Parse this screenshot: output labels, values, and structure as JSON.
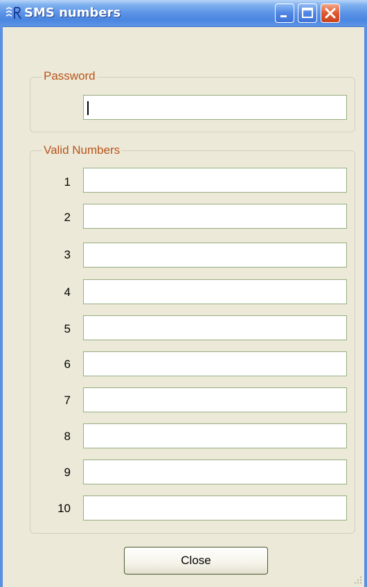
{
  "window": {
    "title": "SMS numbers",
    "app_icon": "app-logo-icon",
    "controls": [
      "minimize-icon",
      "maximize-icon",
      "close-icon"
    ]
  },
  "password_group": {
    "legend": "Password",
    "field_value": ""
  },
  "numbers_group": {
    "legend": "Valid Numbers",
    "rows": [
      {
        "label": "1",
        "value": ""
      },
      {
        "label": "2",
        "value": ""
      },
      {
        "label": "3",
        "value": ""
      },
      {
        "label": "4",
        "value": ""
      },
      {
        "label": "5",
        "value": ""
      },
      {
        "label": "6",
        "value": ""
      },
      {
        "label": "7",
        "value": ""
      },
      {
        "label": "8",
        "value": ""
      },
      {
        "label": "9",
        "value": ""
      },
      {
        "label": "10",
        "value": ""
      }
    ]
  },
  "footer": {
    "close_label": "Close"
  },
  "colors": {
    "titlebar": "#4a86e0",
    "window_bg": "#ece9d8",
    "legend_text": "#b9541b",
    "field_border": "#94ae7e",
    "close_control": "#e0572e"
  }
}
